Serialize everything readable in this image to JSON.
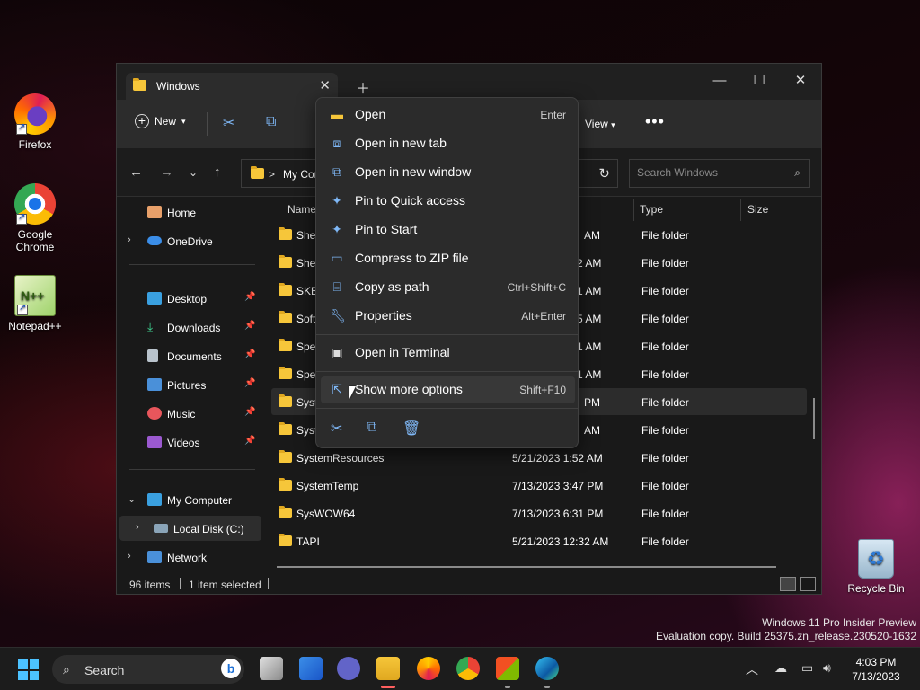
{
  "desktop": {
    "icons": [
      {
        "label": "Firefox"
      },
      {
        "label": "Google\nChrome"
      },
      {
        "label": "Notepad++"
      },
      {
        "label": "Recycle Bin"
      }
    ]
  },
  "window": {
    "tab_title": "Windows",
    "toolbar": {
      "new_label": "New",
      "view_label": "View"
    },
    "address": {
      "separator": ">",
      "crumb": "My Cor"
    },
    "search_placeholder": "Search Windows",
    "sidebar": {
      "home": "Home",
      "onedrive": "OneDrive",
      "desktop": "Desktop",
      "downloads": "Downloads",
      "documents": "Documents",
      "pictures": "Pictures",
      "music": "Music",
      "videos": "Videos",
      "my_computer": "My Computer",
      "local_disk": "Local Disk (C:)",
      "network": "Network"
    },
    "columns": {
      "name": "Name",
      "type": "Type",
      "size": "Size"
    },
    "rows": [
      {
        "name": "Shel",
        "date": "AM",
        "type": "File folder"
      },
      {
        "name": "Shel",
        "date": "2 AM",
        "type": "File folder"
      },
      {
        "name": "SKB",
        "date": "1 AM",
        "type": "File folder"
      },
      {
        "name": "Softv",
        "date": "5 AM",
        "type": "File folder"
      },
      {
        "name": "Spee",
        "date": "1 AM",
        "type": "File folder"
      },
      {
        "name": "Spee",
        "date": "1 AM",
        "type": "File folder"
      },
      {
        "name": "Syst",
        "date": "PM",
        "type": "File folder"
      },
      {
        "name": "Syst",
        "date": "AM",
        "type": "File folder"
      },
      {
        "name": "SystemResources",
        "date": "5/21/2023 1:52 AM",
        "type": "File folder"
      },
      {
        "name": "SystemTemp",
        "date": "7/13/2023 3:47 PM",
        "type": "File folder"
      },
      {
        "name": "SysWOW64",
        "date": "7/13/2023 6:31 PM",
        "type": "File folder"
      },
      {
        "name": "TAPI",
        "date": "5/21/2023 12:32 AM",
        "type": "File folder"
      }
    ],
    "status": {
      "items": "96 items",
      "selected": "1 item selected"
    }
  },
  "context_menu": {
    "items": [
      {
        "label": "Open",
        "shortcut": "Enter",
        "icon": "folder-open-icon"
      },
      {
        "label": "Open in new tab",
        "shortcut": "",
        "icon": "new-tab-icon"
      },
      {
        "label": "Open in new window",
        "shortcut": "",
        "icon": "new-window-icon"
      },
      {
        "label": "Pin to Quick access",
        "shortcut": "",
        "icon": "pin-icon"
      },
      {
        "label": "Pin to Start",
        "shortcut": "",
        "icon": "pin-icon"
      },
      {
        "label": "Compress to ZIP file",
        "shortcut": "",
        "icon": "zip-icon"
      },
      {
        "label": "Copy as path",
        "shortcut": "Ctrl+Shift+C",
        "icon": "copy-path-icon"
      },
      {
        "label": "Properties",
        "shortcut": "Alt+Enter",
        "icon": "wrench-icon"
      },
      {
        "label": "Open in Terminal",
        "shortcut": "",
        "icon": "terminal-icon"
      },
      {
        "label": "Show more options",
        "shortcut": "Shift+F10",
        "icon": "more-options-icon"
      }
    ]
  },
  "watermark": {
    "line1": "Windows 11 Pro Insider Preview",
    "line2": "Evaluation copy. Build 25375.zn_release.230520-1632"
  },
  "taskbar": {
    "search_label": "Search",
    "time": "4:03 PM",
    "date": "7/13/2023"
  },
  "colors": {
    "accent": "#4cc2ff",
    "folder": "#f6c63a",
    "icon_blue": "#7fb8f7"
  }
}
